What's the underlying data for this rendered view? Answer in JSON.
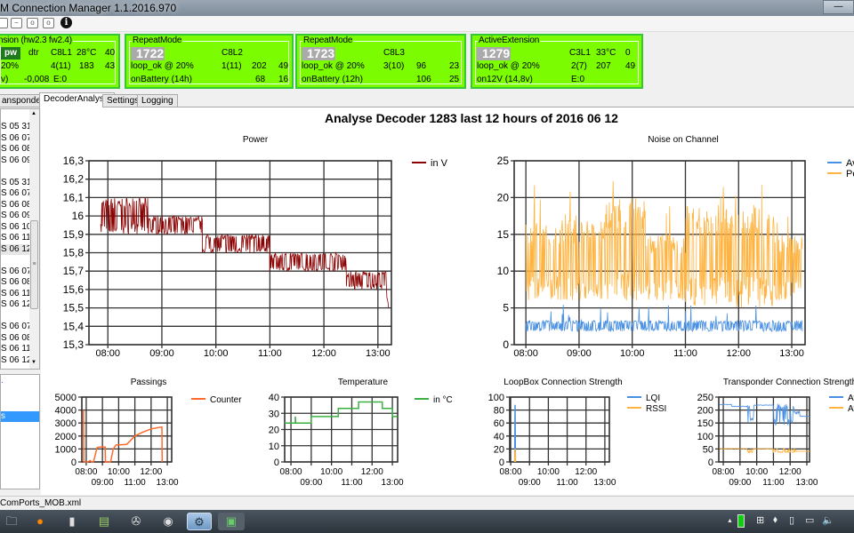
{
  "window": {
    "title": "M Connection Manager 1.1.2016.970",
    "minimize": "—"
  },
  "toolbar": {
    "info_icon": "i"
  },
  "panels": [
    {
      "legend": "nsion (hw2.3 fw2.4)",
      "badge": "pw",
      "r1": [
        "dtr",
        "C8L1",
        "28°C",
        "40"
      ],
      "r2": [
        "20%",
        "4(11)",
        "183",
        "43"
      ],
      "r3": [
        "v)",
        "-0,008",
        "E:0"
      ]
    },
    {
      "legend": "RepeatMode",
      "number": "1722",
      "r1": [
        "C8L2"
      ],
      "r2": [
        "loop_ok @ 20%",
        "1(11)",
        "202",
        "49"
      ],
      "r3": [
        "onBattery (14h)",
        "68",
        "16"
      ]
    },
    {
      "legend": "RepeatMode",
      "number": "1723",
      "r1": [
        "C8L3"
      ],
      "r2": [
        "loop_ok @ 20%",
        "3(10)",
        "96",
        "23"
      ],
      "r3": [
        "onBattery (12h)",
        "106",
        "25"
      ]
    },
    {
      "legend": "ActiveExtension",
      "number": "1279",
      "r1": [
        "C3L1",
        "33°C",
        "0"
      ],
      "r2": [
        "loop_ok @ 20%",
        "2(7)",
        "207",
        "49"
      ],
      "r3": [
        "on12V (14,8v)",
        "E:0"
      ]
    }
  ],
  "tabs": [
    {
      "label": "ansponder"
    },
    {
      "label": "DecoderAnalysis",
      "selected": true
    },
    {
      "label": "Settings"
    },
    {
      "label": "Logging"
    }
  ],
  "list1": {
    "groups": [
      [
        "S 05 31",
        "S 06 07",
        "S 06 08",
        "S 06 09"
      ],
      [
        "S 05 31",
        "S 06 07",
        "S 06 08",
        "S 06 09",
        "S 06 10",
        "S 06 11",
        "S 06 12"
      ],
      [
        "S 06 07",
        "S 06 08",
        "S 06 11",
        "S 06 12"
      ],
      [
        "S 06 07",
        "S 06 08",
        "S 06 11",
        "S 06 12"
      ]
    ],
    "selected": "S 06 12 (group 2)"
  },
  "list2": {
    "items": [
      ".",
      "s"
    ],
    "selected": "s"
  },
  "statusbar": {
    "text": "ComPorts_MOB.xml"
  },
  "main": {
    "title": "Analyse Decoder 1283 last 12 hours of 2016 06 12"
  },
  "chart_data": [
    {
      "id": "power",
      "type": "line",
      "title": "Power",
      "ylim": [
        15.3,
        16.3
      ],
      "yticks": [
        "15,3",
        "15,4",
        "15,5",
        "15,6",
        "15,7",
        "15,8",
        "15,9",
        "16",
        "16,1",
        "16,2",
        "16,3"
      ],
      "xticks": [
        "08:00",
        "09:00",
        "10:00",
        "11:00",
        "12:00",
        "13:00"
      ],
      "grid": true,
      "legend": "right",
      "series": [
        {
          "name": "in V",
          "color": "#8b0000",
          "bands": [
            {
              "from": "07:52",
              "to": "08:45",
              "min": 15.9,
              "max": 16.1
            },
            {
              "from": "08:45",
              "to": "09:45",
              "min": 15.9,
              "max": 16.0
            },
            {
              "from": "09:45",
              "to": "11:00",
              "min": 15.8,
              "max": 15.9
            },
            {
              "from": "11:00",
              "to": "12:25",
              "min": 15.7,
              "max": 15.8
            },
            {
              "from": "12:25",
              "to": "13:10",
              "min": 15.6,
              "max": 15.7
            },
            {
              "from": "13:10",
              "to": "13:12",
              "min": 15.5,
              "max": 15.7
            }
          ]
        }
      ]
    },
    {
      "id": "noise",
      "type": "line",
      "title": "Noise on Channel",
      "ylim": [
        0,
        25
      ],
      "yticks": [
        "0",
        "5",
        "10",
        "15",
        "20",
        "25"
      ],
      "xticks": [
        "08:00",
        "09:00",
        "10:00",
        "11:00",
        "12:00",
        "13:00"
      ],
      "grid": true,
      "legend": "right",
      "series": [
        {
          "name": "Av",
          "color": "#4a90e2",
          "bands": [
            {
              "from": "08:00",
              "to": "13:12",
              "min": 1.8,
              "max": 3.3,
              "spike": 5.5
            }
          ]
        },
        {
          "name": "Pe",
          "color": "#ffb340",
          "bands": [
            {
              "from": "08:00",
              "to": "09:30",
              "min": 6,
              "max": 17,
              "spike": 22
            },
            {
              "from": "09:30",
              "to": "10:15",
              "min": 6,
              "max": 20,
              "spike": 24
            },
            {
              "from": "10:15",
              "to": "11:00",
              "min": 6,
              "max": 15,
              "spike": 19
            },
            {
              "from": "11:00",
              "to": "12:40",
              "min": 5,
              "max": 19,
              "spike": 24
            },
            {
              "from": "12:40",
              "to": "13:12",
              "min": 6,
              "max": 15,
              "spike": 18
            }
          ]
        }
      ]
    },
    {
      "id": "passings",
      "type": "line",
      "title": "Passings",
      "ylim": [
        0,
        5000
      ],
      "yticks": [
        "0",
        "1000",
        "2000",
        "3000",
        "4000",
        "5000"
      ],
      "xticks": [
        "08:00",
        "09:00",
        "10:00",
        "11:00",
        "12:00",
        "13:00"
      ],
      "grid": true,
      "legend": "right",
      "series": [
        {
          "name": "Counter",
          "color": "#ff6a2a",
          "points": [
            [
              "07:50",
              4000
            ],
            [
              "07:51",
              0
            ],
            [
              "08:05",
              0
            ],
            [
              "08:15",
              100
            ],
            [
              "08:20",
              0
            ],
            [
              "08:27",
              0
            ],
            [
              "08:40",
              1100
            ],
            [
              "08:50",
              1150
            ],
            [
              "09:10",
              1150
            ],
            [
              "09:11",
              0
            ],
            [
              "09:30",
              0
            ],
            [
              "09:40",
              1000
            ],
            [
              "09:50",
              1300
            ],
            [
              "10:30",
              1350
            ],
            [
              "11:00",
              2000
            ],
            [
              "11:30",
              2300
            ],
            [
              "12:00",
              2550
            ],
            [
              "12:40",
              2700
            ],
            [
              "12:41",
              0
            ]
          ]
        }
      ]
    },
    {
      "id": "temperature",
      "type": "line",
      "title": "Temperature",
      "ylim": [
        0,
        40
      ],
      "yticks": [
        "0",
        "10",
        "20",
        "30",
        "40"
      ],
      "xticks": [
        "08:00",
        "09:00",
        "10:00",
        "11:00",
        "12:00",
        "13:00"
      ],
      "grid": true,
      "legend": "right",
      "series": [
        {
          "name": "in °C",
          "color": "#3cb043",
          "points": [
            [
              "07:41",
              24
            ],
            [
              "08:13",
              24
            ],
            [
              "08:13",
              28
            ],
            [
              "08:14",
              24
            ],
            [
              "09:00",
              24
            ],
            [
              "09:00",
              28
            ],
            [
              "10:20",
              28
            ],
            [
              "10:20",
              33
            ],
            [
              "11:20",
              33
            ],
            [
              "11:20",
              37
            ],
            [
              "12:30",
              37
            ],
            [
              "12:30",
              33
            ],
            [
              "13:00",
              33
            ],
            [
              "13:00",
              28
            ],
            [
              "13:15",
              28
            ]
          ]
        }
      ]
    },
    {
      "id": "loopbox",
      "type": "line",
      "title": "LoopBox Connection Strength",
      "ylim": [
        0,
        100
      ],
      "yticks": [
        "0",
        "20",
        "40",
        "60",
        "80",
        "100"
      ],
      "xticks": [
        "08:00",
        "09:00",
        "10:00",
        "11:00",
        "12:00",
        "13:00"
      ],
      "grid": true,
      "legend": "right",
      "series": [
        {
          "name": "LQI",
          "color": "#4a90e2",
          "points": [
            [
              "08:13",
              0
            ],
            [
              "08:14",
              88
            ],
            [
              "08:15",
              0
            ]
          ]
        },
        {
          "name": "RSSI",
          "color": "#ffb340",
          "points": [
            [
              "08:13",
              0
            ],
            [
              "08:14",
              20
            ],
            [
              "08:15",
              0
            ]
          ]
        }
      ]
    },
    {
      "id": "transponder",
      "type": "line",
      "title": "Transponder Connection Strength",
      "ylim": [
        0,
        250
      ],
      "yticks": [
        "0",
        "50",
        "100",
        "150",
        "200",
        "250"
      ],
      "xticks": [
        "08:00",
        "09:00",
        "10:00",
        "11:00",
        "12:00",
        "13:00"
      ],
      "grid": true,
      "legend": "right",
      "series": [
        {
          "name": "Av",
          "color": "#4a90e2",
          "bands": [
            {
              "from": "07:45",
              "to": "08:30",
              "min": 220,
              "max": 222
            },
            {
              "from": "08:30",
              "to": "09:25",
              "min": 213,
              "max": 215
            },
            {
              "from": "09:25",
              "to": "09:50",
              "min": 150,
              "max": 225
            },
            {
              "from": "09:50",
              "to": "11:00",
              "min": 218,
              "max": 220
            },
            {
              "from": "11:00",
              "to": "12:15",
              "min": 140,
              "max": 225
            },
            {
              "from": "12:15",
              "to": "12:35",
              "min": 185,
              "max": 195
            },
            {
              "from": "12:35",
              "to": "13:10",
              "min": 175,
              "max": 177
            }
          ]
        },
        {
          "name": "Av",
          "color": "#ffb340",
          "bands": [
            {
              "from": "07:45",
              "to": "09:25",
              "min": 50,
              "max": 52
            },
            {
              "from": "09:25",
              "to": "09:50",
              "min": 35,
              "max": 50
            },
            {
              "from": "09:50",
              "to": "11:00",
              "min": 49,
              "max": 51
            },
            {
              "from": "11:00",
              "to": "12:20",
              "min": 35,
              "max": 52
            },
            {
              "from": "12:20",
              "to": "13:10",
              "min": 40,
              "max": 42
            }
          ]
        }
      ]
    }
  ],
  "taskbar": {
    "apps": [
      "explorer",
      "firefox",
      "phone",
      "notepad",
      "media",
      "maps",
      "settings",
      "monitor"
    ],
    "tray": [
      "▲",
      "battery",
      "flag",
      "network",
      "usb",
      "display",
      "volume"
    ]
  },
  "colors": {
    "panel_green": "#7cfc00",
    "panel_border": "#34c934"
  }
}
